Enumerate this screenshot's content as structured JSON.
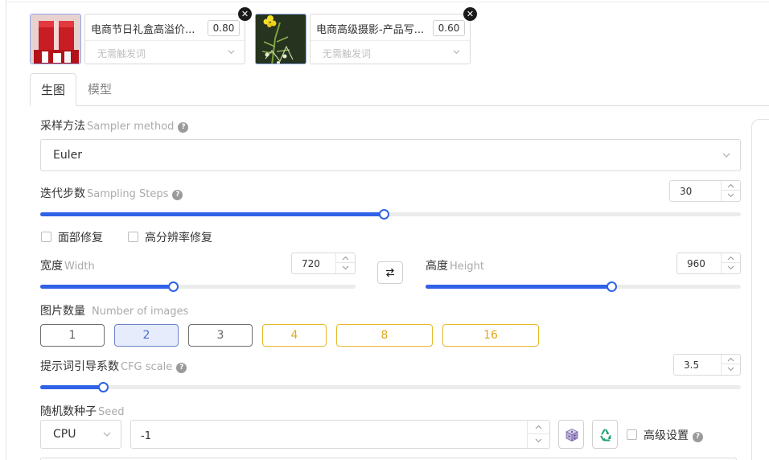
{
  "loras": [
    {
      "name": "电商节日礼盒高溢价...",
      "weight": "0.80",
      "trigger_placeholder": "无需触发词",
      "close": "✕"
    },
    {
      "name": "电商高级摄影-产品写...",
      "weight": "0.60",
      "trigger_placeholder": "无需触发词",
      "close": "✕"
    }
  ],
  "tabs": [
    {
      "label": "生图",
      "active": true
    },
    {
      "label": "模型",
      "active": false
    }
  ],
  "sampler": {
    "label": "采样方法",
    "label_en": "Sampler method",
    "value": "Euler"
  },
  "steps": {
    "label": "迭代步数",
    "label_en": "Sampling Steps",
    "value": "30",
    "fill": 0.49
  },
  "options": {
    "face_restore": "面部修复",
    "hires_fix": "高分辨率修复"
  },
  "width": {
    "label": "宽度",
    "label_en": "Width",
    "value": "720",
    "fill": 0.42
  },
  "height": {
    "label": "高度",
    "label_en": "Height",
    "value": "960",
    "fill": 0.59
  },
  "images": {
    "label": "图片数量",
    "label_en": "Number of images",
    "counts": [
      "1",
      "2",
      "3",
      "4",
      "8",
      "16"
    ],
    "selected": "2"
  },
  "cfg": {
    "label": "提示词引导系数",
    "label_en": "CFG scale",
    "value": "3.5",
    "fill": 0.09
  },
  "seed": {
    "label": "随机数种子",
    "label_en": "Seed",
    "device": "CPU",
    "value": "-1",
    "advanced": "高级设置"
  },
  "help_glyph": "?",
  "colors": {
    "accent": "#2f62e6",
    "gold": "#e7b92a",
    "selected_bg": "#e6ecfb"
  }
}
